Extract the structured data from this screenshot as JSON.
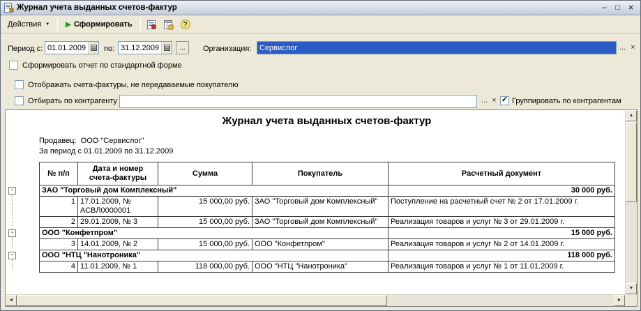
{
  "window": {
    "title": "Журнал учета выданных счетов-фактур",
    "minimize_glyph": "–",
    "maximize_glyph": "□",
    "close_glyph": "×"
  },
  "toolbar": {
    "actions_label": "Действия",
    "actions_arrow": "▼",
    "generate_icon": "▶",
    "generate_label": "Сформировать",
    "help_glyph": "?"
  },
  "filters": {
    "period_from_label": "Период с:",
    "period_from_value": "01.01.2009",
    "period_to_label": "по:",
    "period_to_value": "31.12.2009",
    "period_more_label": "...",
    "organization_label": "Организация:",
    "organization_value": "Сервислог",
    "org_select_label": "...",
    "org_clear_glyph": "×",
    "standard_form_label": "Сформировать отчет по стандартной форме",
    "show_not_transferred_label": "Отображать счета-фактуры, не передаваемые покупателю",
    "filter_by_contractor_label": "Отбирать по контрагенту",
    "contractor_value": "",
    "contractor_select_label": "...",
    "contractor_clear_glyph": "×",
    "group_by_contractor_label": "Группировать по контрагентам",
    "checkmark_glyph": "✓"
  },
  "report": {
    "title": "Журнал учета выданных счетов-фактур",
    "seller_label": "Продавец:",
    "seller_value": "ООО \"Сервислог\"",
    "period_line": "За период с 01.01.2009 по 31.12.2009",
    "collapse_glyph": "-",
    "columns": [
      "№ п/п",
      "Дата и номер счета-фактуры",
      "Сумма",
      "Покупатель",
      "Расчетный документ"
    ],
    "groups": [
      {
        "name": "ЗАО \"Торговый дом Комплексный\"",
        "total": "30 000 руб.",
        "rows": [
          {
            "num": "1",
            "date": "17.01.2009, № АСВЛ0000001",
            "sum": "15 000,00 руб.",
            "buyer": "ЗАО \"Торговый дом Комплексный\"",
            "doc": "Поступление на расчетный счет № 2 от 17.01.2009 г."
          },
          {
            "num": "2",
            "date": "29.01.2009, № 3",
            "sum": "15 000,00 руб.",
            "buyer": "ЗАО \"Торговый дом Комплексный\"",
            "doc": "Реализация товаров и услуг № 3 от 29.01.2009 г."
          }
        ]
      },
      {
        "name": "ООО \"Конфетпром\"",
        "total": "15 000 руб.",
        "rows": [
          {
            "num": "3",
            "date": "14.01.2009, № 2",
            "sum": "15 000,00 руб.",
            "buyer": "ООО \"Конфетпром\"",
            "doc": "Реализация товаров и услуг № 2 от 14.01.2009 г."
          }
        ]
      },
      {
        "name": "ООО \"НТЦ \"Нанотроника\"",
        "total": "118 000 руб.",
        "rows": [
          {
            "num": "4",
            "date": "11.01.2009, № 1",
            "sum": "118 000,00 руб.",
            "buyer": "ООО \"НТЦ \"Нанотроника\"",
            "doc": "Реализация товаров и услуг № 1 от 11.01.2009 г."
          }
        ]
      }
    ]
  },
  "colors": {
    "selection_blue": "#2b5cc5",
    "generate_green": "#1d9a1d"
  }
}
